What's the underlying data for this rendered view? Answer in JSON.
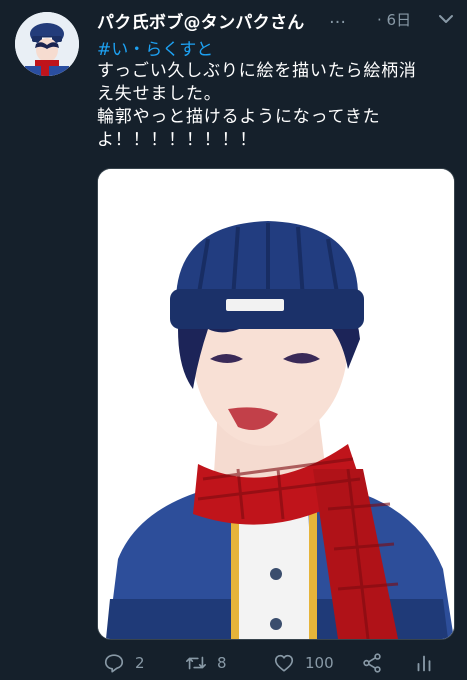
{
  "tweet": {
    "display_name": "パク氏ボブ@タンパクさん",
    "ellipsis": "…",
    "time": "· 6日",
    "hashtag": "#い・らくすと",
    "lines": [
      "すっごい久しぶりに絵を描いたら絵柄消",
      "え失せました。",
      "輪郭やっと描けるようになってきた",
      "よ！！！！！！！！"
    ]
  },
  "actions": {
    "reply_count": "2",
    "retweet_count": "8",
    "like_count": "100"
  },
  "icons": {
    "avatar": "avatar-image",
    "caret": "chevron-down-icon",
    "reply": "reply-icon",
    "retweet": "retweet-icon",
    "like": "heart-icon",
    "share": "share-icon",
    "analytics": "analytics-icon"
  },
  "colors": {
    "background": "#15202b",
    "link": "#1da1f2",
    "muted": "#8899a6",
    "beanie": "#1f3a78",
    "scarf": "#c0141b"
  }
}
